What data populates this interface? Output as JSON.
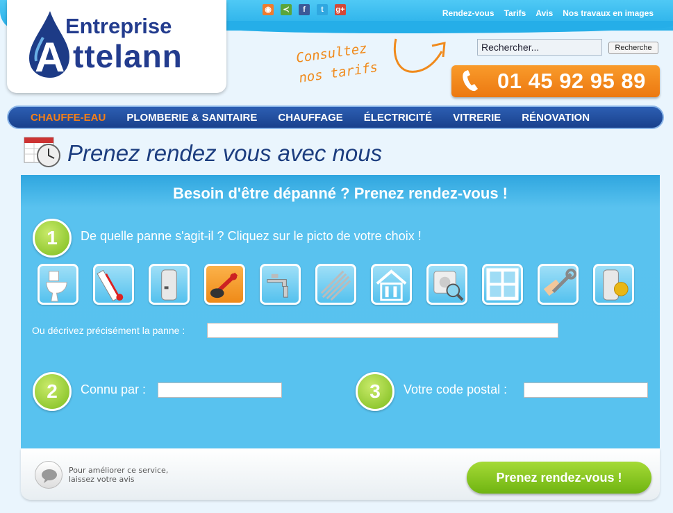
{
  "logo": {
    "line1": "Entreprise",
    "line2": "ttelann",
    "letter": "A"
  },
  "social": [
    {
      "name": "rss-icon",
      "glyph": "◉",
      "color": "#f07b2d"
    },
    {
      "name": "share-icon",
      "glyph": "≺",
      "color": "#5aa53a"
    },
    {
      "name": "facebook-icon",
      "glyph": "f",
      "color": "#3b5998"
    },
    {
      "name": "twitter-icon",
      "glyph": "t",
      "color": "#2fa7e0"
    },
    {
      "name": "googleplus-icon",
      "glyph": "g+",
      "color": "#d34836"
    }
  ],
  "toplinks": [
    "Rendez-vous",
    "Tarifs",
    "Avis",
    "Nos travaux en images"
  ],
  "promo": {
    "line1": "Consultez",
    "line2": "nos tarifs"
  },
  "search": {
    "value": "Rechercher...",
    "button": "Recherche"
  },
  "phone": "01 45 92 95 89",
  "nav": [
    "CHAUFFE-EAU",
    "PLOMBERIE & SANITAIRE",
    "CHAUFFAGE",
    "ÉLECTRICITÉ",
    "VITRERIE",
    "RÉNOVATION"
  ],
  "page_title": "Prenez rendez vous avec nous",
  "panel": {
    "heading": "Besoin d'être dépanné ? Prenez rendez-vous !",
    "step1": {
      "number": "1",
      "question": "De quelle panne s'agit-il ? Cliquez sur le picto de votre choix !"
    },
    "pictos": [
      "toilet-icon",
      "thermometer-icon",
      "water-heater-icon",
      "plunger-icon",
      "faucet-icon",
      "pipes-icon",
      "house-tools-icon",
      "socket-magnifier-icon",
      "window-icon",
      "wrench-hand-icon",
      "certified-heater-icon"
    ],
    "describe_label": "Ou décrivez précisément la panne :",
    "step2": {
      "number": "2",
      "label": "Connu par :"
    },
    "step3": {
      "number": "3",
      "label": "Votre code postal :"
    }
  },
  "footer": {
    "avis_line1": "Pour améliorer ce service,",
    "avis_line2": "laissez votre avis",
    "cta": "Prenez rendez-vous !"
  }
}
